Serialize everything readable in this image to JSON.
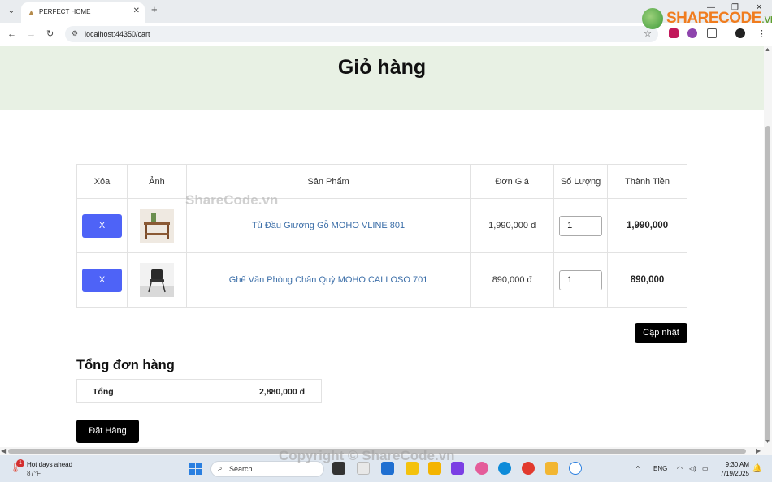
{
  "browser": {
    "tab_title": "PERFECT HOME",
    "url": "localhost:44350/cart",
    "window_controls": [
      "—",
      "❐",
      "✕"
    ]
  },
  "watermark": {
    "logo_main": "SHARECODE",
    "logo_suffix": ".vn",
    "center_text": "ShareCode.vn",
    "bottom_text": "Copyright © ShareCode.vn"
  },
  "page": {
    "title": "Giỏ hàng"
  },
  "cart_table": {
    "headers": [
      "Xóa",
      "Ảnh",
      "Sản Phẩm",
      "Đơn Giá",
      "Số Lượng",
      "Thành Tiền"
    ],
    "rows": [
      {
        "remove_label": "X",
        "product": "Tủ Đầu Giường Gỗ MOHO VLINE 801",
        "unit_price": "1,990,000 đ",
        "quantity": "1",
        "line_total": "1,990,000"
      },
      {
        "remove_label": "X",
        "product": "Ghế Văn Phòng Chân Quỳ MOHO CALLOSO 701",
        "unit_price": "890,000 đ",
        "quantity": "1",
        "line_total": "890,000"
      }
    ]
  },
  "update_button": "Cập nhật",
  "summary": {
    "title": "Tổng đơn hàng",
    "label": "Tổng",
    "value": "2,880,000 đ"
  },
  "order_button": "Đặt Hàng",
  "taskbar": {
    "weather_title": "Hot days ahead",
    "weather_temp": "87°F",
    "weather_badge": "1",
    "search_placeholder": "Search",
    "language": "ENG",
    "time": "9:30 AM",
    "date": "7/19/2025"
  }
}
